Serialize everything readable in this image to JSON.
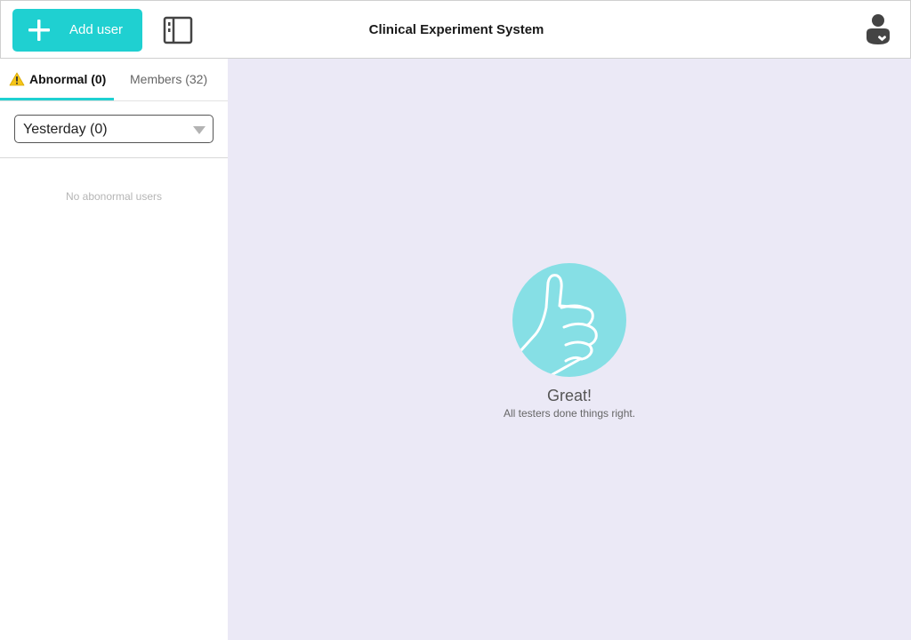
{
  "header": {
    "add_user_label": "Add user",
    "title": "Clinical Experiment System",
    "accent_color": "#1fd0d1"
  },
  "sidebar": {
    "tabs": [
      {
        "label": "Abnormal (0)",
        "active": true,
        "icon": "warning-icon"
      },
      {
        "label": "Members (32)",
        "active": false
      }
    ],
    "filter": {
      "selected": "Yesterday (0)"
    },
    "empty_message": "No abonormal users"
  },
  "main": {
    "headline": "Great!",
    "message": "All testers done things right.",
    "icon": "thumbs-up-icon",
    "background_color": "#ebe9f6"
  }
}
